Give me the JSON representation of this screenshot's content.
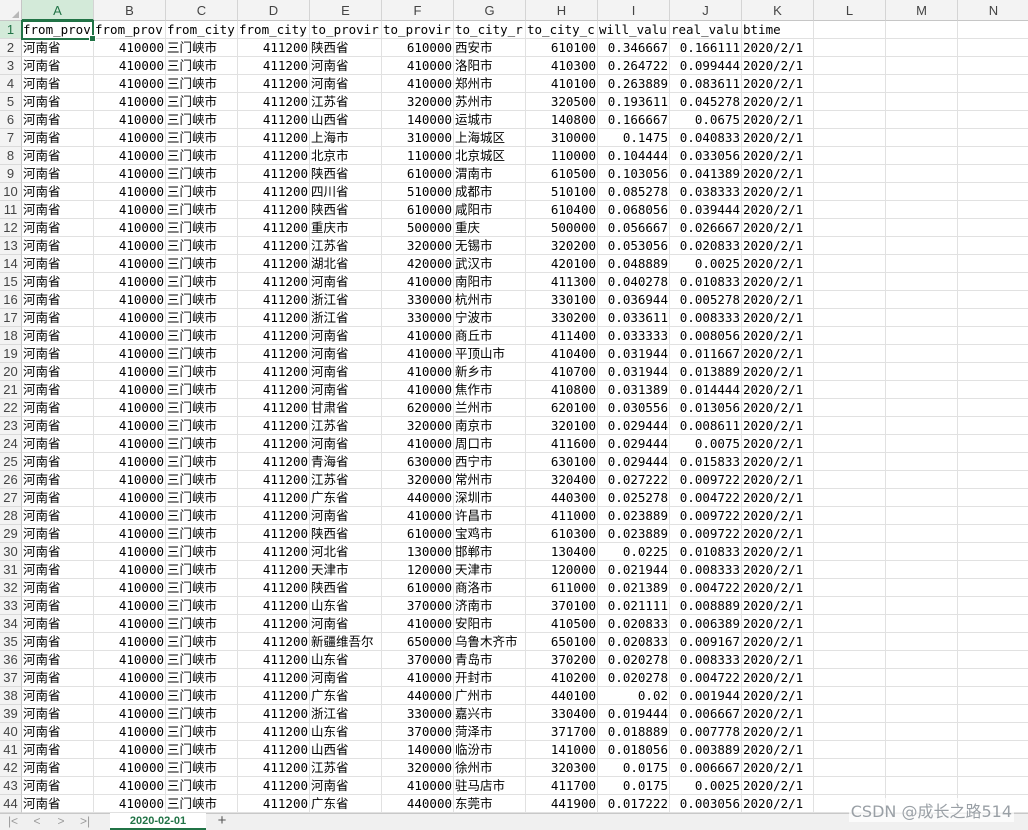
{
  "columns": [
    "A",
    "B",
    "C",
    "D",
    "E",
    "F",
    "G",
    "H",
    "I",
    "J",
    "K",
    "L",
    "M",
    "N"
  ],
  "active_cell": {
    "column": "A",
    "row": "1"
  },
  "header_row": [
    "from_prov",
    "from_prov",
    "from_city",
    "from_city",
    "to_provir",
    "to_provir",
    "to_city_r",
    "to_city_c",
    "will_valu",
    "real_valu",
    "btime"
  ],
  "rows": [
    {
      "n": "2",
      "a": "河南省",
      "b": "410000",
      "c": "三门峡市",
      "d": "411200",
      "e": "陕西省",
      "f": "610000",
      "g": "西安市",
      "h": "610100",
      "i": "0.346667",
      "j": "0.166111",
      "k": "2020/2/1"
    },
    {
      "n": "3",
      "a": "河南省",
      "b": "410000",
      "c": "三门峡市",
      "d": "411200",
      "e": "河南省",
      "f": "410000",
      "g": "洛阳市",
      "h": "410300",
      "i": "0.264722",
      "j": "0.099444",
      "k": "2020/2/1"
    },
    {
      "n": "4",
      "a": "河南省",
      "b": "410000",
      "c": "三门峡市",
      "d": "411200",
      "e": "河南省",
      "f": "410000",
      "g": "郑州市",
      "h": "410100",
      "i": "0.263889",
      "j": "0.083611",
      "k": "2020/2/1"
    },
    {
      "n": "5",
      "a": "河南省",
      "b": "410000",
      "c": "三门峡市",
      "d": "411200",
      "e": "江苏省",
      "f": "320000",
      "g": "苏州市",
      "h": "320500",
      "i": "0.193611",
      "j": "0.045278",
      "k": "2020/2/1"
    },
    {
      "n": "6",
      "a": "河南省",
      "b": "410000",
      "c": "三门峡市",
      "d": "411200",
      "e": "山西省",
      "f": "140000",
      "g": "运城市",
      "h": "140800",
      "i": "0.166667",
      "j": "0.0675",
      "k": "2020/2/1"
    },
    {
      "n": "7",
      "a": "河南省",
      "b": "410000",
      "c": "三门峡市",
      "d": "411200",
      "e": "上海市",
      "f": "310000",
      "g": "上海城区",
      "h": "310000",
      "i": "0.1475",
      "j": "0.040833",
      "k": "2020/2/1"
    },
    {
      "n": "8",
      "a": "河南省",
      "b": "410000",
      "c": "三门峡市",
      "d": "411200",
      "e": "北京市",
      "f": "110000",
      "g": "北京城区",
      "h": "110000",
      "i": "0.104444",
      "j": "0.033056",
      "k": "2020/2/1"
    },
    {
      "n": "9",
      "a": "河南省",
      "b": "410000",
      "c": "三门峡市",
      "d": "411200",
      "e": "陕西省",
      "f": "610000",
      "g": "渭南市",
      "h": "610500",
      "i": "0.103056",
      "j": "0.041389",
      "k": "2020/2/1"
    },
    {
      "n": "10",
      "a": "河南省",
      "b": "410000",
      "c": "三门峡市",
      "d": "411200",
      "e": "四川省",
      "f": "510000",
      "g": "成都市",
      "h": "510100",
      "i": "0.085278",
      "j": "0.038333",
      "k": "2020/2/1"
    },
    {
      "n": "11",
      "a": "河南省",
      "b": "410000",
      "c": "三门峡市",
      "d": "411200",
      "e": "陕西省",
      "f": "610000",
      "g": "咸阳市",
      "h": "610400",
      "i": "0.068056",
      "j": "0.039444",
      "k": "2020/2/1"
    },
    {
      "n": "12",
      "a": "河南省",
      "b": "410000",
      "c": "三门峡市",
      "d": "411200",
      "e": "重庆市",
      "f": "500000",
      "g": "重庆",
      "h": "500000",
      "i": "0.056667",
      "j": "0.026667",
      "k": "2020/2/1"
    },
    {
      "n": "13",
      "a": "河南省",
      "b": "410000",
      "c": "三门峡市",
      "d": "411200",
      "e": "江苏省",
      "f": "320000",
      "g": "无锡市",
      "h": "320200",
      "i": "0.053056",
      "j": "0.020833",
      "k": "2020/2/1"
    },
    {
      "n": "14",
      "a": "河南省",
      "b": "410000",
      "c": "三门峡市",
      "d": "411200",
      "e": "湖北省",
      "f": "420000",
      "g": "武汉市",
      "h": "420100",
      "i": "0.048889",
      "j": "0.0025",
      "k": "2020/2/1"
    },
    {
      "n": "15",
      "a": "河南省",
      "b": "410000",
      "c": "三门峡市",
      "d": "411200",
      "e": "河南省",
      "f": "410000",
      "g": "南阳市",
      "h": "411300",
      "i": "0.040278",
      "j": "0.010833",
      "k": "2020/2/1"
    },
    {
      "n": "16",
      "a": "河南省",
      "b": "410000",
      "c": "三门峡市",
      "d": "411200",
      "e": "浙江省",
      "f": "330000",
      "g": "杭州市",
      "h": "330100",
      "i": "0.036944",
      "j": "0.005278",
      "k": "2020/2/1"
    },
    {
      "n": "17",
      "a": "河南省",
      "b": "410000",
      "c": "三门峡市",
      "d": "411200",
      "e": "浙江省",
      "f": "330000",
      "g": "宁波市",
      "h": "330200",
      "i": "0.033611",
      "j": "0.008333",
      "k": "2020/2/1"
    },
    {
      "n": "18",
      "a": "河南省",
      "b": "410000",
      "c": "三门峡市",
      "d": "411200",
      "e": "河南省",
      "f": "410000",
      "g": "商丘市",
      "h": "411400",
      "i": "0.033333",
      "j": "0.008056",
      "k": "2020/2/1"
    },
    {
      "n": "19",
      "a": "河南省",
      "b": "410000",
      "c": "三门峡市",
      "d": "411200",
      "e": "河南省",
      "f": "410000",
      "g": "平顶山市",
      "h": "410400",
      "i": "0.031944",
      "j": "0.011667",
      "k": "2020/2/1"
    },
    {
      "n": "20",
      "a": "河南省",
      "b": "410000",
      "c": "三门峡市",
      "d": "411200",
      "e": "河南省",
      "f": "410000",
      "g": "新乡市",
      "h": "410700",
      "i": "0.031944",
      "j": "0.013889",
      "k": "2020/2/1"
    },
    {
      "n": "21",
      "a": "河南省",
      "b": "410000",
      "c": "三门峡市",
      "d": "411200",
      "e": "河南省",
      "f": "410000",
      "g": "焦作市",
      "h": "410800",
      "i": "0.031389",
      "j": "0.014444",
      "k": "2020/2/1"
    },
    {
      "n": "22",
      "a": "河南省",
      "b": "410000",
      "c": "三门峡市",
      "d": "411200",
      "e": "甘肃省",
      "f": "620000",
      "g": "兰州市",
      "h": "620100",
      "i": "0.030556",
      "j": "0.013056",
      "k": "2020/2/1"
    },
    {
      "n": "23",
      "a": "河南省",
      "b": "410000",
      "c": "三门峡市",
      "d": "411200",
      "e": "江苏省",
      "f": "320000",
      "g": "南京市",
      "h": "320100",
      "i": "0.029444",
      "j": "0.008611",
      "k": "2020/2/1"
    },
    {
      "n": "24",
      "a": "河南省",
      "b": "410000",
      "c": "三门峡市",
      "d": "411200",
      "e": "河南省",
      "f": "410000",
      "g": "周口市",
      "h": "411600",
      "i": "0.029444",
      "j": "0.0075",
      "k": "2020/2/1"
    },
    {
      "n": "25",
      "a": "河南省",
      "b": "410000",
      "c": "三门峡市",
      "d": "411200",
      "e": "青海省",
      "f": "630000",
      "g": "西宁市",
      "h": "630100",
      "i": "0.029444",
      "j": "0.015833",
      "k": "2020/2/1"
    },
    {
      "n": "26",
      "a": "河南省",
      "b": "410000",
      "c": "三门峡市",
      "d": "411200",
      "e": "江苏省",
      "f": "320000",
      "g": "常州市",
      "h": "320400",
      "i": "0.027222",
      "j": "0.009722",
      "k": "2020/2/1"
    },
    {
      "n": "27",
      "a": "河南省",
      "b": "410000",
      "c": "三门峡市",
      "d": "411200",
      "e": "广东省",
      "f": "440000",
      "g": "深圳市",
      "h": "440300",
      "i": "0.025278",
      "j": "0.004722",
      "k": "2020/2/1"
    },
    {
      "n": "28",
      "a": "河南省",
      "b": "410000",
      "c": "三门峡市",
      "d": "411200",
      "e": "河南省",
      "f": "410000",
      "g": "许昌市",
      "h": "411000",
      "i": "0.023889",
      "j": "0.009722",
      "k": "2020/2/1"
    },
    {
      "n": "29",
      "a": "河南省",
      "b": "410000",
      "c": "三门峡市",
      "d": "411200",
      "e": "陕西省",
      "f": "610000",
      "g": "宝鸡市",
      "h": "610300",
      "i": "0.023889",
      "j": "0.009722",
      "k": "2020/2/1"
    },
    {
      "n": "30",
      "a": "河南省",
      "b": "410000",
      "c": "三门峡市",
      "d": "411200",
      "e": "河北省",
      "f": "130000",
      "g": "邯郸市",
      "h": "130400",
      "i": "0.0225",
      "j": "0.010833",
      "k": "2020/2/1"
    },
    {
      "n": "31",
      "a": "河南省",
      "b": "410000",
      "c": "三门峡市",
      "d": "411200",
      "e": "天津市",
      "f": "120000",
      "g": "天津市",
      "h": "120000",
      "i": "0.021944",
      "j": "0.008333",
      "k": "2020/2/1"
    },
    {
      "n": "32",
      "a": "河南省",
      "b": "410000",
      "c": "三门峡市",
      "d": "411200",
      "e": "陕西省",
      "f": "610000",
      "g": "商洛市",
      "h": "611000",
      "i": "0.021389",
      "j": "0.004722",
      "k": "2020/2/1"
    },
    {
      "n": "33",
      "a": "河南省",
      "b": "410000",
      "c": "三门峡市",
      "d": "411200",
      "e": "山东省",
      "f": "370000",
      "g": "济南市",
      "h": "370100",
      "i": "0.021111",
      "j": "0.008889",
      "k": "2020/2/1"
    },
    {
      "n": "34",
      "a": "河南省",
      "b": "410000",
      "c": "三门峡市",
      "d": "411200",
      "e": "河南省",
      "f": "410000",
      "g": "安阳市",
      "h": "410500",
      "i": "0.020833",
      "j": "0.006389",
      "k": "2020/2/1"
    },
    {
      "n": "35",
      "a": "河南省",
      "b": "410000",
      "c": "三门峡市",
      "d": "411200",
      "e": "新疆维吾尔",
      "f": "650000",
      "g": "乌鲁木齐市",
      "h": "650100",
      "i": "0.020833",
      "j": "0.009167",
      "k": "2020/2/1"
    },
    {
      "n": "36",
      "a": "河南省",
      "b": "410000",
      "c": "三门峡市",
      "d": "411200",
      "e": "山东省",
      "f": "370000",
      "g": "青岛市",
      "h": "370200",
      "i": "0.020278",
      "j": "0.008333",
      "k": "2020/2/1"
    },
    {
      "n": "37",
      "a": "河南省",
      "b": "410000",
      "c": "三门峡市",
      "d": "411200",
      "e": "河南省",
      "f": "410000",
      "g": "开封市",
      "h": "410200",
      "i": "0.020278",
      "j": "0.004722",
      "k": "2020/2/1"
    },
    {
      "n": "38",
      "a": "河南省",
      "b": "410000",
      "c": "三门峡市",
      "d": "411200",
      "e": "广东省",
      "f": "440000",
      "g": "广州市",
      "h": "440100",
      "i": "0.02",
      "j": "0.001944",
      "k": "2020/2/1"
    },
    {
      "n": "39",
      "a": "河南省",
      "b": "410000",
      "c": "三门峡市",
      "d": "411200",
      "e": "浙江省",
      "f": "330000",
      "g": "嘉兴市",
      "h": "330400",
      "i": "0.019444",
      "j": "0.006667",
      "k": "2020/2/1"
    },
    {
      "n": "40",
      "a": "河南省",
      "b": "410000",
      "c": "三门峡市",
      "d": "411200",
      "e": "山东省",
      "f": "370000",
      "g": "菏泽市",
      "h": "371700",
      "i": "0.018889",
      "j": "0.007778",
      "k": "2020/2/1"
    },
    {
      "n": "41",
      "a": "河南省",
      "b": "410000",
      "c": "三门峡市",
      "d": "411200",
      "e": "山西省",
      "f": "140000",
      "g": "临汾市",
      "h": "141000",
      "i": "0.018056",
      "j": "0.003889",
      "k": "2020/2/1"
    },
    {
      "n": "42",
      "a": "河南省",
      "b": "410000",
      "c": "三门峡市",
      "d": "411200",
      "e": "江苏省",
      "f": "320000",
      "g": "徐州市",
      "h": "320300",
      "i": "0.0175",
      "j": "0.006667",
      "k": "2020/2/1"
    },
    {
      "n": "43",
      "a": "河南省",
      "b": "410000",
      "c": "三门峡市",
      "d": "411200",
      "e": "河南省",
      "f": "410000",
      "g": "驻马店市",
      "h": "411700",
      "i": "0.0175",
      "j": "0.0025",
      "k": "2020/2/1"
    },
    {
      "n": "44",
      "a": "河南省",
      "b": "410000",
      "c": "三门峡市",
      "d": "411200",
      "e": "广东省",
      "f": "440000",
      "g": "东莞市",
      "h": "441900",
      "i": "0.017222",
      "j": "0.003056",
      "k": "2020/2/1"
    }
  ],
  "sheet_tab": {
    "label": "2020-02-01",
    "add_label": "+"
  },
  "nav": {
    "first": "|<",
    "prev": "<",
    "next": ">",
    "last": ">|"
  },
  "watermark": "CSDN @成长之路514",
  "colors": {
    "accent": "#217346",
    "header_bg": "#f3f3f3",
    "grid": "#e1e1e1"
  }
}
